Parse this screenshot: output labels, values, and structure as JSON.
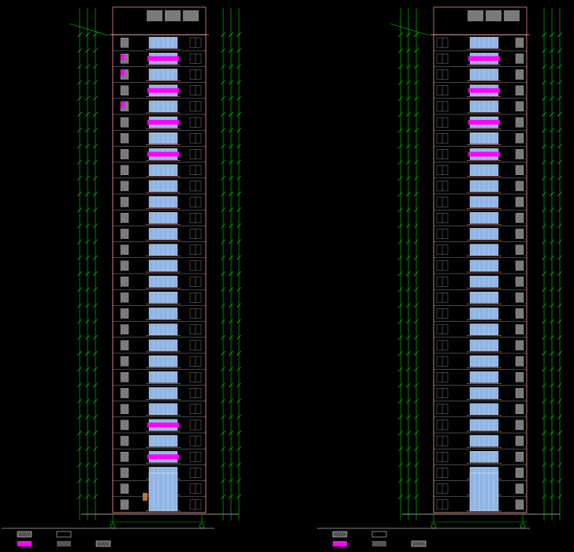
{
  "app": {
    "title": ""
  },
  "drawing": {
    "elevation_a_title": "",
    "elevation_b_title": "",
    "axis_left_start": "",
    "axis_left_end": "",
    "axis_right_start": "",
    "axis_right_end": ""
  },
  "legend": [
    {
      "swatch": "hatch-gray",
      "label": ""
    },
    {
      "swatch": "magenta",
      "label": ""
    },
    {
      "swatch": "outline",
      "label": ""
    },
    {
      "swatch": "dark-gray",
      "label": ""
    },
    {
      "swatch": "hatch-dense",
      "label": ""
    }
  ],
  "colors": {
    "background": "#000000",
    "dimension_lines": "#00d400",
    "building_outline": "#ff9a9a",
    "window_glazing": "#8fb5e6",
    "accent_panels": "#ff00ff",
    "floor_lines": "#c8c8c8",
    "roof_boxes": "#7a7a7a"
  }
}
